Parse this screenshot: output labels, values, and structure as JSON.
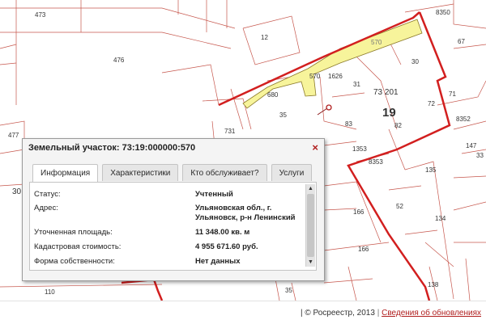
{
  "map": {
    "parcel_labels": [
      "473",
      "12",
      "476",
      "570",
      "8350",
      "67",
      "30",
      "680",
      "570",
      "1626",
      "31",
      "73 201",
      "19",
      "72",
      "35",
      "83",
      "82",
      "8352",
      "71",
      "477",
      "731",
      "1353",
      "147",
      "8353",
      "135",
      "166",
      "52",
      "134",
      "166",
      "30",
      "110",
      "138",
      "35",
      "33"
    ],
    "colors": {
      "boundary": "#d21f1f",
      "highlight": "#f7f49b",
      "lines": "#c6564c"
    }
  },
  "popup": {
    "title": "Земельный участок: 73:19:000000:570",
    "close_label": "×",
    "tabs": [
      "Информация",
      "Характеристики",
      "Кто обслуживает?",
      "Услуги"
    ],
    "rows": [
      {
        "label": "Статус:",
        "value": "Учтенный"
      },
      {
        "label": "Адрес:",
        "value": "Ульяновская обл., г. Ульяновск, р-н Ленинский"
      },
      {
        "label": "Уточненная площадь:",
        "value": "11 348.00 кв. м"
      },
      {
        "label": "Кадастровая стоимость:",
        "value": "4 955 671.60 руб."
      },
      {
        "label": "Форма собственности:",
        "value": "Нет данных"
      }
    ]
  },
  "footer": {
    "copyright": "© Росреестр, 2013",
    "separator": "|",
    "link": "Сведения об обновлениях"
  }
}
